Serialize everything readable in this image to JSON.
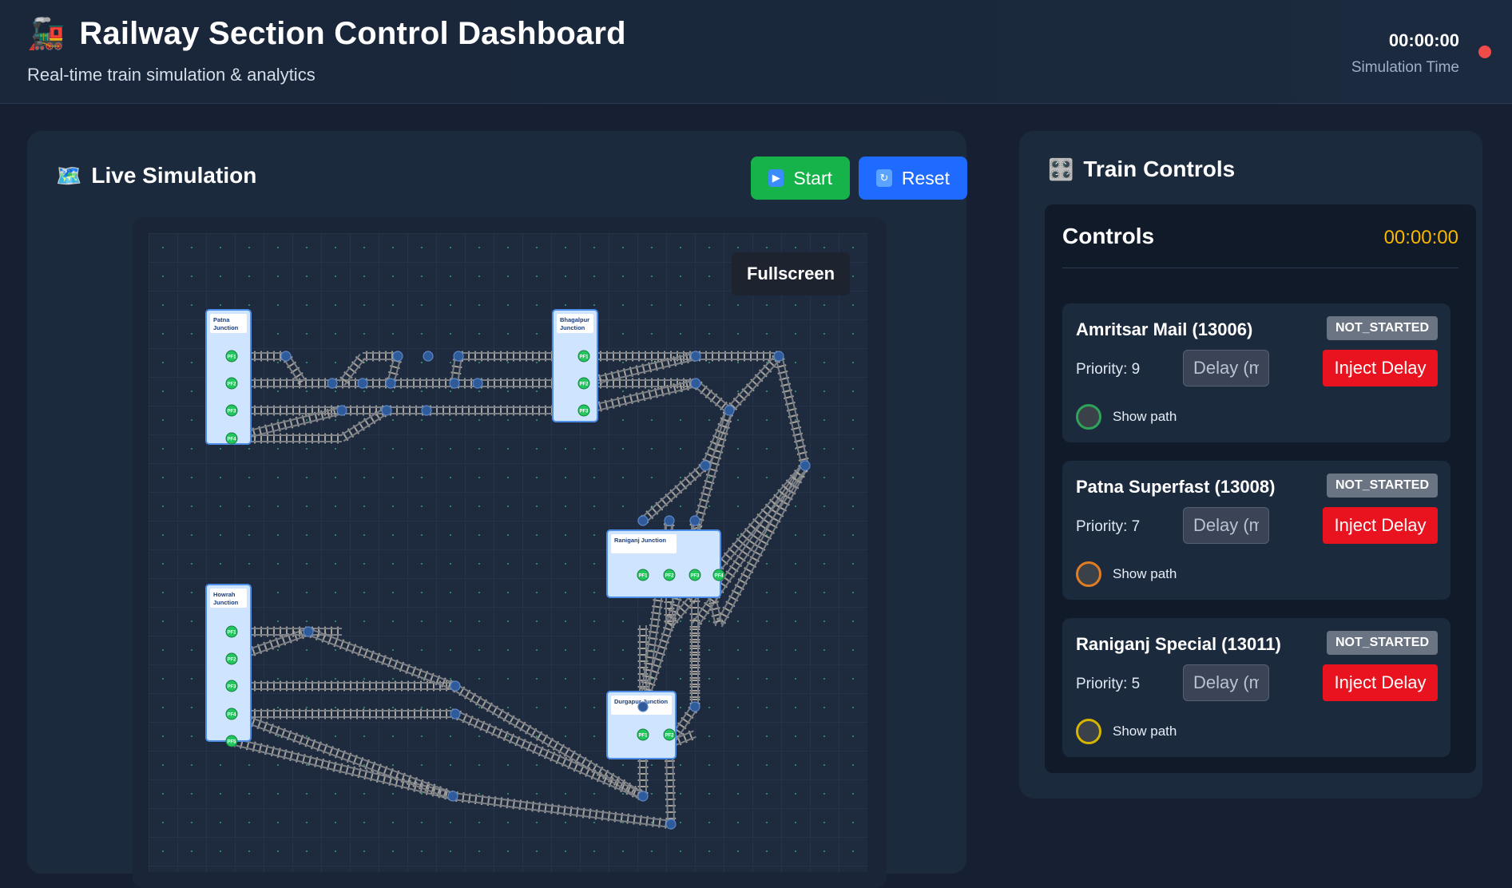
{
  "header": {
    "icon": "train-icon",
    "title": "Railway Section Control Dashboard",
    "subtitle": "Real-time train simulation & analytics",
    "sim_time": "00:00:00",
    "sim_time_label": "Simulation Time",
    "status_color": "#ef4b4b"
  },
  "simulation": {
    "title": "Live Simulation",
    "icon": "map-icon",
    "start_label": "Start",
    "reset_label": "Reset",
    "fullscreen_label": "Fullscreen",
    "stations": [
      {
        "name": "Patna Junction",
        "line1": "Patna",
        "line2": "Junction",
        "platforms": [
          "PF1",
          "PF2",
          "PF3",
          "PF4"
        ]
      },
      {
        "name": "Bhagalpur Junction",
        "line1": "Bhagalpur",
        "line2": "Junction",
        "platforms": [
          "PF1",
          "PF2",
          "PF3"
        ]
      },
      {
        "name": "Raniganj Junction",
        "line1": "Raniganj Junction",
        "line2": "",
        "platforms": [
          "PF1",
          "PF2",
          "PF3",
          "PF4"
        ]
      },
      {
        "name": "Howrah Junction",
        "line1": "Howrah",
        "line2": "Junction",
        "platforms": [
          "PF1",
          "PF2",
          "PF3",
          "PF4",
          "PF5"
        ]
      },
      {
        "name": "Durgapur Junction",
        "line1": "Durgapur Junction",
        "line2": "",
        "platforms": [
          "PF1",
          "PF2"
        ]
      }
    ]
  },
  "controls": {
    "title": "Train Controls",
    "icon": "control-panel-icon",
    "card_title": "Controls",
    "card_time": "00:00:00",
    "time_color": "#f7b600",
    "delay_placeholder": "Delay (min)",
    "inject_label": "Inject Delay",
    "show_path_label": "Show path",
    "trains": [
      {
        "name": "Amritsar Mail (13006)",
        "status": "NOT_STARTED",
        "priority": "Priority: 9",
        "path_color": "#2fa35a"
      },
      {
        "name": "Patna Superfast (13008)",
        "status": "NOT_STARTED",
        "priority": "Priority: 7",
        "path_color": "#e07c24"
      },
      {
        "name": "Raniganj Special (13011)",
        "status": "NOT_STARTED",
        "priority": "Priority: 5",
        "path_color": "#d6b400"
      }
    ]
  }
}
